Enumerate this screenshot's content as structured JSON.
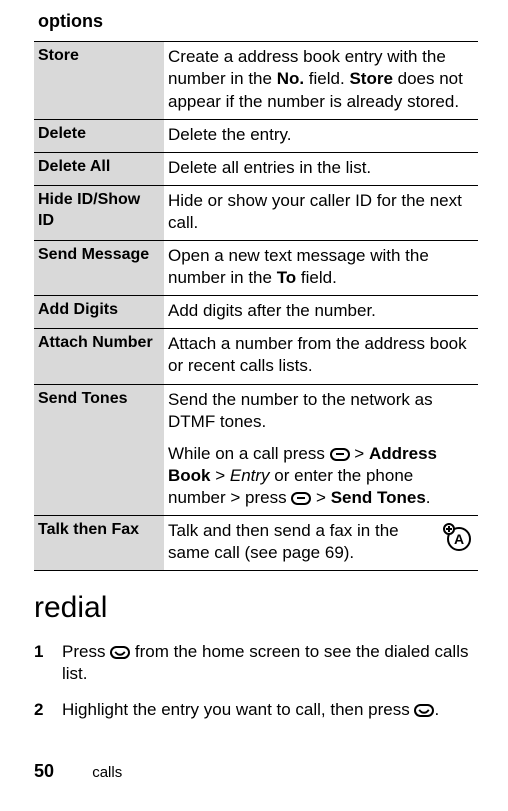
{
  "table": {
    "header": "options",
    "rows": [
      {
        "name": "Store",
        "desc_parts": [
          {
            "t": "text",
            "v": "Create a address book entry with the number in the "
          },
          {
            "t": "cond_bold",
            "v": "No."
          },
          {
            "t": "text",
            "v": " field. "
          },
          {
            "t": "cond_bold",
            "v": "Store"
          },
          {
            "t": "text",
            "v": " does not appear if the number is already stored."
          }
        ]
      },
      {
        "name": "Delete",
        "desc_parts": [
          {
            "t": "text",
            "v": "Delete the entry."
          }
        ]
      },
      {
        "name": "Delete All",
        "desc_parts": [
          {
            "t": "text",
            "v": "Delete all entries in the list."
          }
        ]
      },
      {
        "name": "Hide ID/Show ID",
        "desc_parts": [
          {
            "t": "text",
            "v": "Hide or show your caller ID for the next call."
          }
        ]
      },
      {
        "name": "Send Message",
        "desc_parts": [
          {
            "t": "text",
            "v": "Open a new text message with the number in the "
          },
          {
            "t": "cond_bold",
            "v": "To"
          },
          {
            "t": "text",
            "v": " field."
          }
        ]
      },
      {
        "name": "Add Digits",
        "desc_parts": [
          {
            "t": "text",
            "v": "Add digits after the number."
          }
        ]
      },
      {
        "name": "Attach Number",
        "desc_parts": [
          {
            "t": "text",
            "v": "Attach a number from the address book or recent calls lists."
          }
        ]
      },
      {
        "name": "Send Tones",
        "desc_paras": [
          [
            {
              "t": "text",
              "v": "Send the number to the network as DTMF tones."
            }
          ],
          [
            {
              "t": "text",
              "v": "While on a call press "
            },
            {
              "t": "key",
              "v": "minus"
            },
            {
              "t": "text",
              "v": " > "
            },
            {
              "t": "cond_bold",
              "v": "Address Book"
            },
            {
              "t": "text",
              "v": " > "
            },
            {
              "t": "italic",
              "v": "Entry"
            },
            {
              "t": "text",
              "v": " or enter the phone number > press "
            },
            {
              "t": "key",
              "v": "minus"
            },
            {
              "t": "text",
              "v": " > "
            },
            {
              "t": "cond_bold",
              "v": "Send Tones"
            },
            {
              "t": "text",
              "v": "."
            }
          ]
        ]
      },
      {
        "name": "Talk then Fax",
        "desc_parts": [
          {
            "t": "text",
            "v": "Talk and then send a fax in the same call (see page 69)."
          }
        ],
        "badge": true
      }
    ]
  },
  "section_heading": "redial",
  "steps": [
    [
      {
        "t": "text",
        "v": "Press "
      },
      {
        "t": "key",
        "v": "call"
      },
      {
        "t": "text",
        "v": " from the home screen to see the dialed calls list."
      }
    ],
    [
      {
        "t": "text",
        "v": "Highlight the entry you want to call, then press "
      },
      {
        "t": "key",
        "v": "call"
      },
      {
        "t": "text",
        "v": "."
      }
    ]
  ],
  "footer": {
    "page_number": "50",
    "section": "calls"
  }
}
